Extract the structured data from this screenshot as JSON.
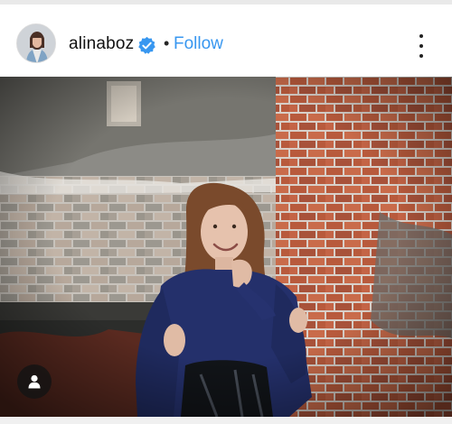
{
  "post": {
    "username": "alinaboz",
    "separator": "•",
    "follow_label": "Follow",
    "verified": true,
    "accent_color": "#3897f0"
  },
  "icons": {
    "verified": "verified-badge-icon",
    "more": "more-options-icon",
    "user_tag": "user-tag-icon"
  }
}
